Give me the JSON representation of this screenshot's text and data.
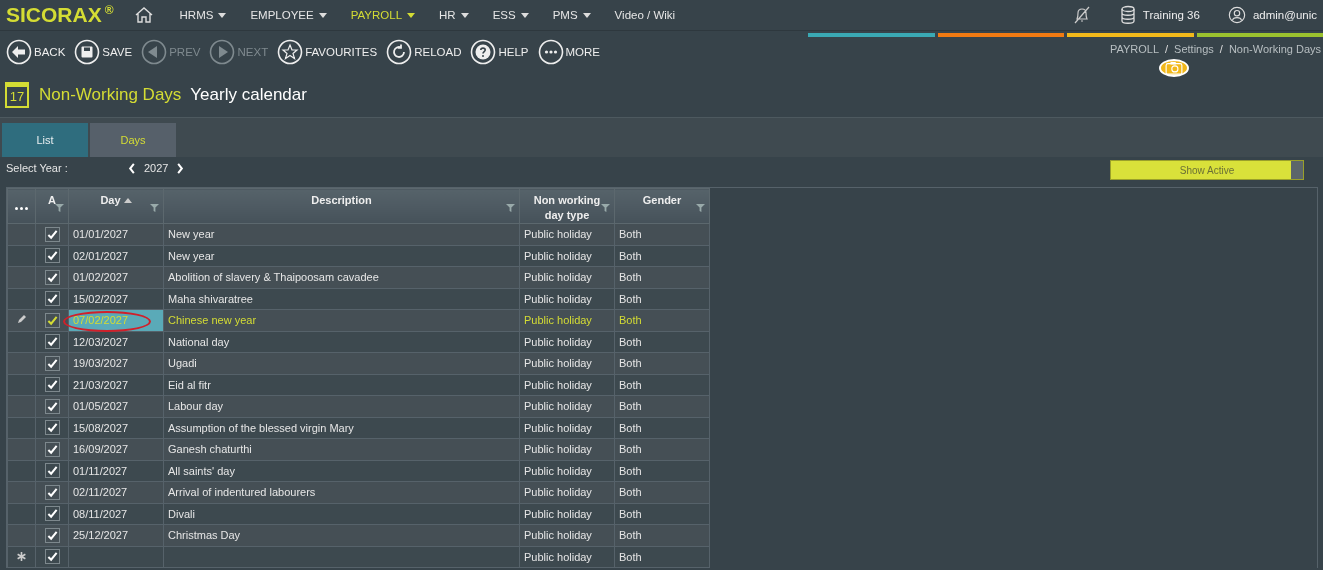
{
  "brand": {
    "name": "SICORAX",
    "mark": "®"
  },
  "menu": [
    {
      "label": "HRMS",
      "selected": false,
      "caret": true
    },
    {
      "label": "EMPLOYEE",
      "selected": false,
      "caret": true
    },
    {
      "label": "PAYROLL",
      "selected": true,
      "caret": true
    },
    {
      "label": "HR",
      "selected": false,
      "caret": true
    },
    {
      "label": "ESS",
      "selected": false,
      "caret": true
    },
    {
      "label": "PMS",
      "selected": false,
      "caret": true
    },
    {
      "label": "Video / Wiki",
      "selected": false,
      "caret": false
    }
  ],
  "session": {
    "database": "Training 36",
    "user": "admin@unic"
  },
  "toolbar": [
    {
      "kind": "back",
      "label": "BACK",
      "disabled": false
    },
    {
      "kind": "save",
      "label": "SAVE",
      "disabled": false
    },
    {
      "kind": "prev",
      "label": "PREV",
      "disabled": true
    },
    {
      "kind": "next",
      "label": "NEXT",
      "disabled": true
    },
    {
      "kind": "favourites",
      "label": "FAVOURITES",
      "disabled": false
    },
    {
      "kind": "reload",
      "label": "RELOAD",
      "disabled": false
    },
    {
      "kind": "help",
      "label": "HELP",
      "disabled": false
    },
    {
      "kind": "more",
      "label": "MORE",
      "disabled": false
    }
  ],
  "color_bars": [
    {
      "color": "#3aa9b4"
    },
    {
      "color": "#f07a12"
    },
    {
      "color": "#f2b81a"
    },
    {
      "color": "#9bc12e"
    }
  ],
  "breadcrumb": [
    {
      "label": "PAYROLL",
      "separator": "/"
    },
    {
      "label": "Settings",
      "separator": "/"
    },
    {
      "label": "Non-Working Days"
    }
  ],
  "page": {
    "title": "Non-Working Days",
    "subtitle": "Yearly calendar",
    "calendar_day": "17"
  },
  "tabs": [
    {
      "label": "List",
      "selected": true
    },
    {
      "label": "Days",
      "selected": false
    }
  ],
  "year_selector": {
    "label": "Select Year :",
    "value": "2027"
  },
  "show_active": {
    "label": "Show Active",
    "on": true
  },
  "table": {
    "columns": [
      {
        "label": "A",
        "sorted": false
      },
      {
        "label": "Day",
        "sorted": true
      },
      {
        "label": "Description",
        "sorted": false
      },
      {
        "label": "Non working day type",
        "sorted": false
      },
      {
        "label": "Gender",
        "sorted": false
      }
    ],
    "rows": [
      {
        "kind": "data",
        "selected": false,
        "active": true,
        "day": "01/01/2027",
        "description": "New year",
        "type": "Public holiday",
        "gender": "Both"
      },
      {
        "kind": "data",
        "selected": false,
        "active": true,
        "day": "02/01/2027",
        "description": "New year",
        "type": "Public holiday",
        "gender": "Both"
      },
      {
        "kind": "data",
        "selected": false,
        "active": true,
        "day": "01/02/2027",
        "description": "Abolition of slavery & Thaipoosam cavadee",
        "type": "Public holiday",
        "gender": "Both"
      },
      {
        "kind": "data",
        "selected": false,
        "active": true,
        "day": "15/02/2027",
        "description": "Maha shivaratree",
        "type": "Public holiday",
        "gender": "Both"
      },
      {
        "kind": "data",
        "selected": true,
        "circled": true,
        "active": true,
        "day": "07/02/2027",
        "description": "Chinese new year",
        "type": "Public holiday",
        "gender": "Both"
      },
      {
        "kind": "data",
        "selected": false,
        "active": true,
        "day": "12/03/2027",
        "description": "National day",
        "type": "Public holiday",
        "gender": "Both"
      },
      {
        "kind": "data",
        "selected": false,
        "active": true,
        "day": "19/03/2027",
        "description": "Ugadi",
        "type": "Public holiday",
        "gender": "Both"
      },
      {
        "kind": "data",
        "selected": false,
        "active": true,
        "day": "21/03/2027",
        "description": "Eid al fitr",
        "type": "Public holiday",
        "gender": "Both"
      },
      {
        "kind": "data",
        "selected": false,
        "active": true,
        "day": "01/05/2027",
        "description": "Labour day",
        "type": "Public holiday",
        "gender": "Both"
      },
      {
        "kind": "data",
        "selected": false,
        "active": true,
        "day": "15/08/2027",
        "description": "Assumption of the blessed virgin Mary",
        "type": "Public holiday",
        "gender": "Both"
      },
      {
        "kind": "data",
        "selected": false,
        "active": true,
        "day": "16/09/2027",
        "description": "Ganesh chaturthi",
        "type": "Public holiday",
        "gender": "Both"
      },
      {
        "kind": "data",
        "selected": false,
        "active": true,
        "day": "01/11/2027",
        "description": "All saints' day",
        "type": "Public holiday",
        "gender": "Both"
      },
      {
        "kind": "data",
        "selected": false,
        "active": true,
        "day": "02/11/2027",
        "description": "Arrival of indentured labourers",
        "type": "Public holiday",
        "gender": "Both"
      },
      {
        "kind": "data",
        "selected": false,
        "active": true,
        "day": "08/11/2027",
        "description": "Divali",
        "type": "Public holiday",
        "gender": "Both"
      },
      {
        "kind": "data",
        "selected": false,
        "active": true,
        "day": "25/12/2027",
        "description": "Christmas Day",
        "type": "Public holiday",
        "gender": "Both"
      },
      {
        "kind": "new",
        "selected": false,
        "active": true,
        "type": "Public holiday",
        "gender": "Both"
      }
    ]
  }
}
